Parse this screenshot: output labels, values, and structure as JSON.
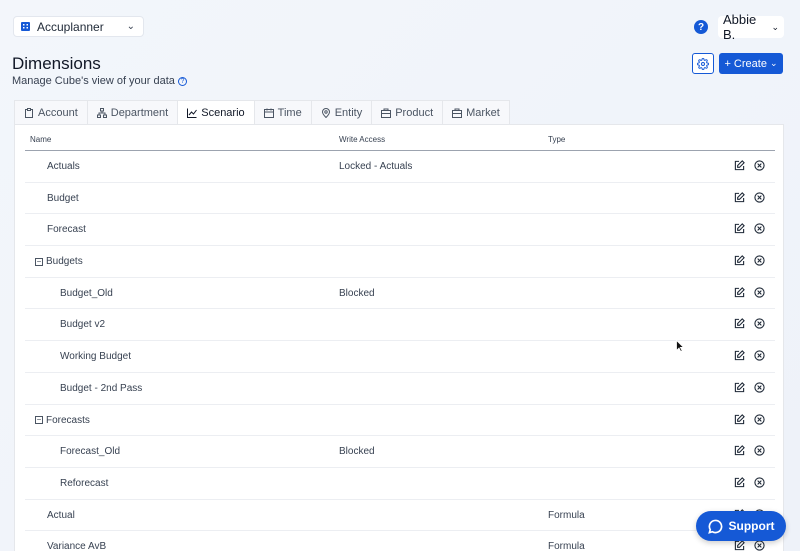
{
  "org_selector": {
    "label": "Accuplanner"
  },
  "user_menu": {
    "name": "Abbie B."
  },
  "help": {
    "label": "?"
  },
  "header": {
    "title": "Dimensions",
    "subtitle": "Manage Cube's view of your data"
  },
  "actions": {
    "create_label": "Create"
  },
  "tabs": [
    {
      "label": "Account",
      "icon": "clipboard-icon"
    },
    {
      "label": "Department",
      "icon": "org-chart-icon"
    },
    {
      "label": "Scenario",
      "icon": "line-chart-icon",
      "active": true
    },
    {
      "label": "Time",
      "icon": "calendar-icon"
    },
    {
      "label": "Entity",
      "icon": "location-pin-icon"
    },
    {
      "label": "Product",
      "icon": "box-icon"
    },
    {
      "label": "Market",
      "icon": "store-icon"
    }
  ],
  "table": {
    "columns": [
      "Name",
      "Write Access",
      "Type"
    ],
    "rows": [
      {
        "name": "Actuals",
        "access": "Locked - Actuals",
        "type": ""
      },
      {
        "name": "Budget",
        "access": "",
        "type": ""
      },
      {
        "name": "Forecast",
        "access": "",
        "type": ""
      },
      {
        "name": "Budgets",
        "access": "",
        "type": ""
      },
      {
        "name": "Budget_Old",
        "access": "Blocked",
        "type": ""
      },
      {
        "name": "Budget v2",
        "access": "",
        "type": ""
      },
      {
        "name": "Working Budget",
        "access": "",
        "type": ""
      },
      {
        "name": "Budget - 2nd Pass",
        "access": "",
        "type": ""
      },
      {
        "name": "Forecasts",
        "access": "",
        "type": ""
      },
      {
        "name": "Forecast_Old",
        "access": "Blocked",
        "type": ""
      },
      {
        "name": "Reforecast",
        "access": "",
        "type": ""
      },
      {
        "name": "Actual",
        "access": "",
        "type": "Formula"
      },
      {
        "name": "Variance AvB",
        "access": "",
        "type": "Formula"
      }
    ]
  },
  "support": {
    "label": "Support"
  },
  "colors": {
    "accent": "#1559d6"
  }
}
